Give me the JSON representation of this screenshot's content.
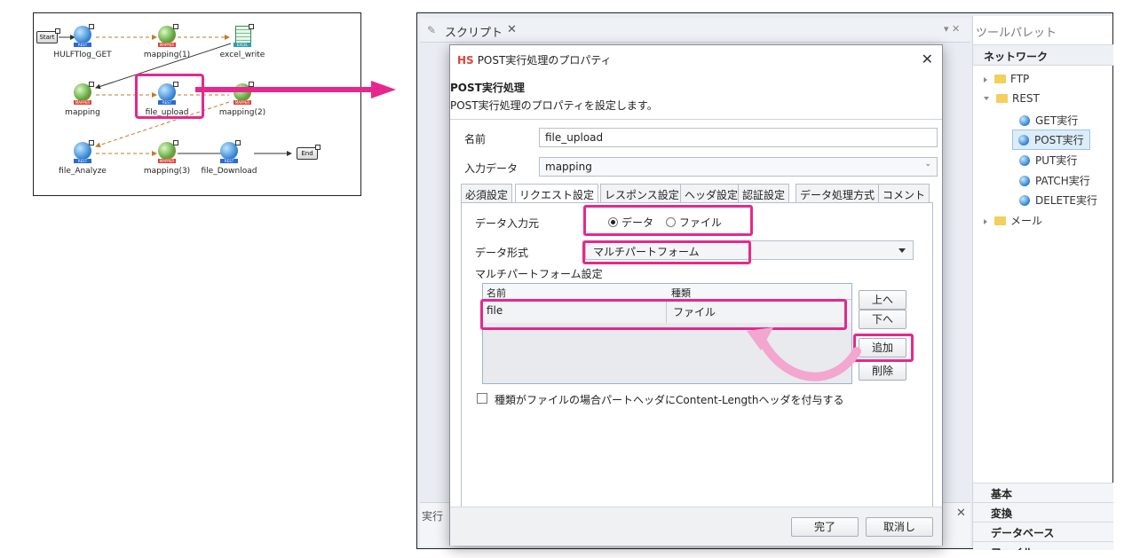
{
  "flow": {
    "terminals": {
      "start": "Start",
      "end": "End"
    },
    "nodes": [
      {
        "label": "HULFTlog_GET",
        "tag": "REST"
      },
      {
        "label": "mapping(1)",
        "tag": "MAPPER"
      },
      {
        "label": "excel_write",
        "tag": "EXCEL"
      },
      {
        "label": "mapping",
        "tag": "MAPPER"
      },
      {
        "label": "file_upload",
        "tag": "REST"
      },
      {
        "label": "mapping(2)",
        "tag": "MAPPER"
      },
      {
        "label": "file_Analyze",
        "tag": "REST"
      },
      {
        "label": "mapping(3)",
        "tag": "MAPPER"
      },
      {
        "label": "file_Download",
        "tag": "REST"
      }
    ]
  },
  "editor": {
    "script_tab": "スクリプト",
    "bottom_tab": "実行"
  },
  "palette": {
    "header": "ツールパレット",
    "title": "ネットワーク",
    "tree": [
      {
        "label": "FTP",
        "kind": "folder",
        "expanded": false
      },
      {
        "label": "REST",
        "kind": "folder",
        "expanded": true
      },
      {
        "label": "GET実行",
        "kind": "leaf"
      },
      {
        "label": "POST実行",
        "kind": "leaf",
        "selected": true
      },
      {
        "label": "PUT実行",
        "kind": "leaf"
      },
      {
        "label": "PATCH実行",
        "kind": "leaf"
      },
      {
        "label": "DELETE実行",
        "kind": "leaf"
      },
      {
        "label": "メール",
        "kind": "folder",
        "expanded": false
      }
    ],
    "categories": [
      "基本",
      "変換",
      "データベース",
      "ファイル"
    ]
  },
  "dialog": {
    "badge": "HS",
    "title": "POST実行処理のプロパティ",
    "heading": "POST実行処理",
    "description": "POST実行処理のプロパティを設定します。",
    "name_label": "名前",
    "name_value": "file_upload",
    "input_label": "入力データ",
    "input_value": "mapping",
    "tabs": [
      "必須設定",
      "リクエスト設定",
      "レスポンス設定",
      "ヘッダ設定",
      "認証設定",
      "データ処理方式",
      "コメント"
    ],
    "active_tab": "リクエスト設定",
    "source_label": "データ入力元",
    "source_options": [
      "データ",
      "ファイル"
    ],
    "source_selected": "データ",
    "format_label": "データ形式",
    "format_value": "マルチパートフォーム",
    "multipart_label": "マルチパートフォーム設定",
    "grid_headers": [
      "名前",
      "種類"
    ],
    "grid_rows": [
      {
        "name": "file",
        "type": "ファイル"
      }
    ],
    "buttons": {
      "up": "上へ",
      "down": "下へ",
      "add": "追加",
      "delete": "削除",
      "ok": "完了",
      "cancel": "取消し"
    },
    "checkbox_label": "種類がファイルの場合パートヘッダにContent-Lengthヘッダを付与する",
    "checkbox_checked": false
  },
  "colors": {
    "highlight": "#e6288c",
    "accent": "#2b7fd1"
  }
}
